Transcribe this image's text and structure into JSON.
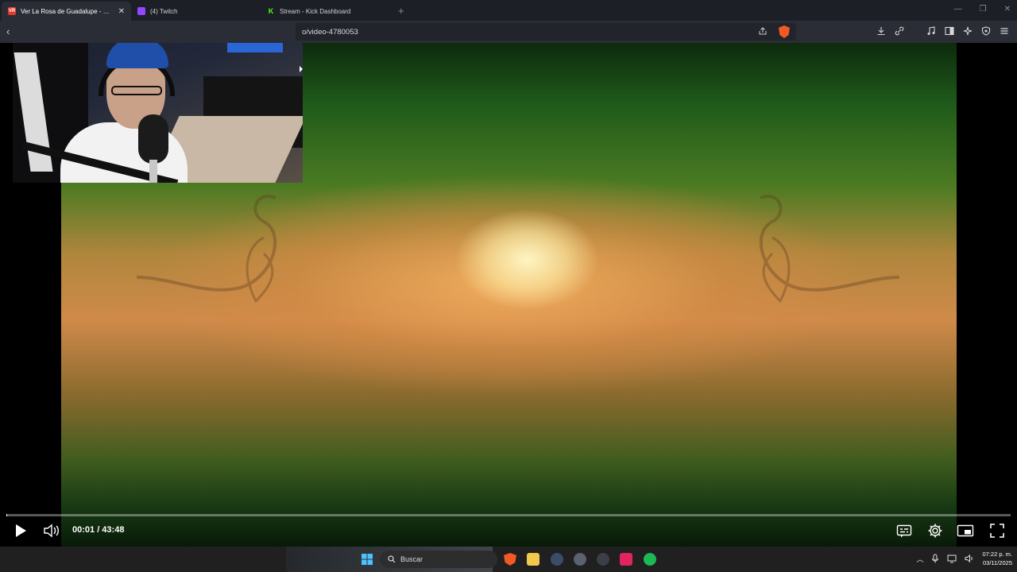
{
  "browser": {
    "tabs": [
      {
        "title": "Ver La Rosa de Guadalupe - Nue",
        "favicon": "ver-icon",
        "favicon_text": "VR",
        "favicon_color": "#e03b2b",
        "active": true
      },
      {
        "title": "(4) Twitch",
        "favicon": "twitch-icon",
        "favicon_color": "#9146ff",
        "active": false
      },
      {
        "title": "Stream - Kick Dashboard",
        "favicon": "kick-icon",
        "favicon_color": "#53fc18",
        "active": false
      }
    ],
    "new_tab_glyph": "+",
    "url": "o/video-4780053"
  },
  "player": {
    "time": "00:01 / 43:48",
    "progress_percent": 0.05
  },
  "taskbar": {
    "search_placeholder": "Buscar",
    "clock_time": "07:22 p. m.",
    "clock_date": "03/11/2025"
  },
  "colors": {
    "accent_brave": "#f15a24",
    "twitch": "#9146ff",
    "kick": "#53fc18"
  }
}
